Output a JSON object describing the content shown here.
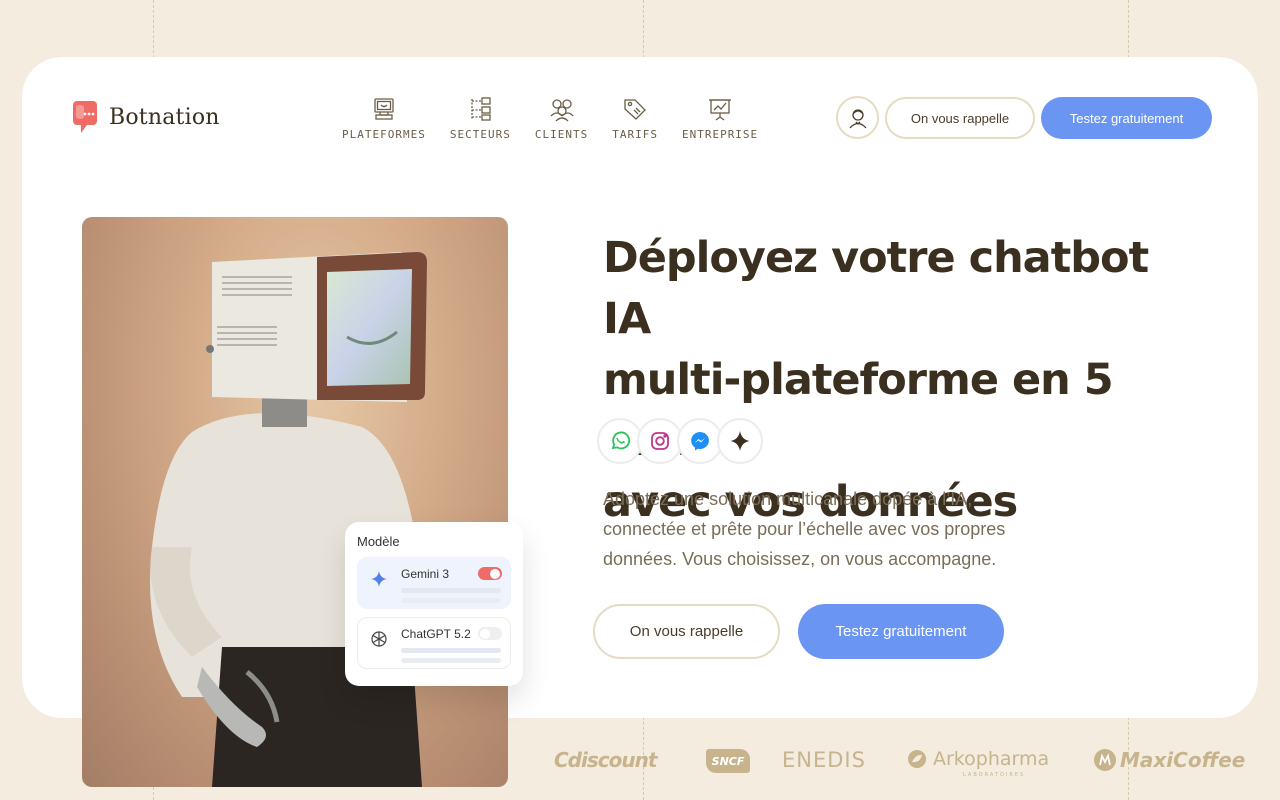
{
  "brand": {
    "name": "Botnation",
    "accent": "#ef6b66",
    "primary": "#6b95f3"
  },
  "nav": {
    "items": [
      {
        "label": "PLATEFORMES",
        "icon": "computer-icon"
      },
      {
        "label": "SECTEURS",
        "icon": "flowchart-icon"
      },
      {
        "label": "CLIENTS",
        "icon": "users-icon"
      },
      {
        "label": "TARIFS",
        "icon": "price-tag-icon"
      },
      {
        "label": "ENTREPRISE",
        "icon": "presentation-icon"
      }
    ]
  },
  "header": {
    "account_icon": "user-icon",
    "callback_label": "On vous rappelle",
    "try_label": "Testez gratuitement"
  },
  "hero": {
    "title_lines": [
      "Déployez votre chatbot IA",
      "multi-plateforme en 5 min,",
      "avec vos données"
    ],
    "channels": [
      "whatsapp-icon",
      "instagram-icon",
      "messenger-icon",
      "sparkle-icon"
    ],
    "description_lines": [
      "Adoptez une solution multicanale dopée à l’IA,",
      "connectée et prête pour l’échelle avec vos propres",
      "données. Vous choisissez, on vous accompagne."
    ],
    "callback_label": "On vous rappelle",
    "try_label": "Testez gratuitement"
  },
  "model_card": {
    "title": "Modèle",
    "models": [
      {
        "name": "Gemini 3",
        "enabled": true,
        "icon": "gemini-icon"
      },
      {
        "name": "ChatGPT 5.2",
        "enabled": false,
        "icon": "openai-icon"
      }
    ]
  },
  "clients": [
    "Cdiscount",
    "SNCF",
    "ENEDIS",
    "Arkopharma",
    "LABORATOIRES",
    "MaxiCoffee"
  ]
}
